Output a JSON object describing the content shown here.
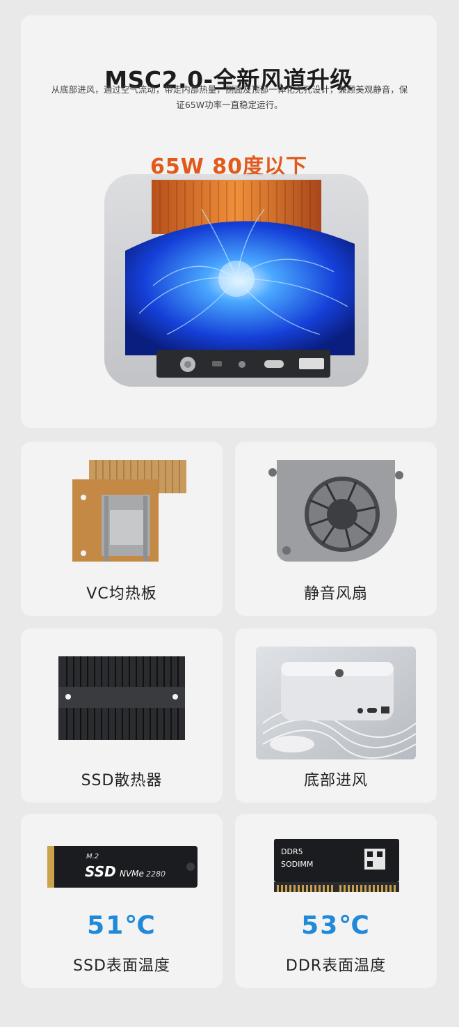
{
  "hero": {
    "title": "MSC2.0-全新风道升级",
    "description": "从底部进风，通过空气流动，带走内部热量，侧面及顶部一体化无孔设计，兼顾美观静音，保证65W功率一直稳定运行。",
    "highlight": "65W 80度以下",
    "highlight_color": "#e05a1c"
  },
  "features": [
    {
      "label": "VC均热板",
      "icon": "vapor-chamber-icon"
    },
    {
      "label": "静音风扇",
      "icon": "fan-icon"
    },
    {
      "label": "SSD散热器",
      "icon": "heatsink-icon"
    },
    {
      "label": "底部进风",
      "icon": "mini-pc-icon"
    }
  ],
  "temps": [
    {
      "value": "51℃",
      "label": "SSD表面温度",
      "icon": "ssd-icon",
      "chip_text_1": "M.2",
      "chip_text_2": "SSD",
      "chip_text_3": "NVMe",
      "chip_text_4": "2280"
    },
    {
      "value": "53℃",
      "label": "DDR表面温度",
      "icon": "ram-icon",
      "chip_text_1": "DDR5",
      "chip_text_2": "SODIMM"
    }
  ],
  "temp_color": "#1f8ad8"
}
